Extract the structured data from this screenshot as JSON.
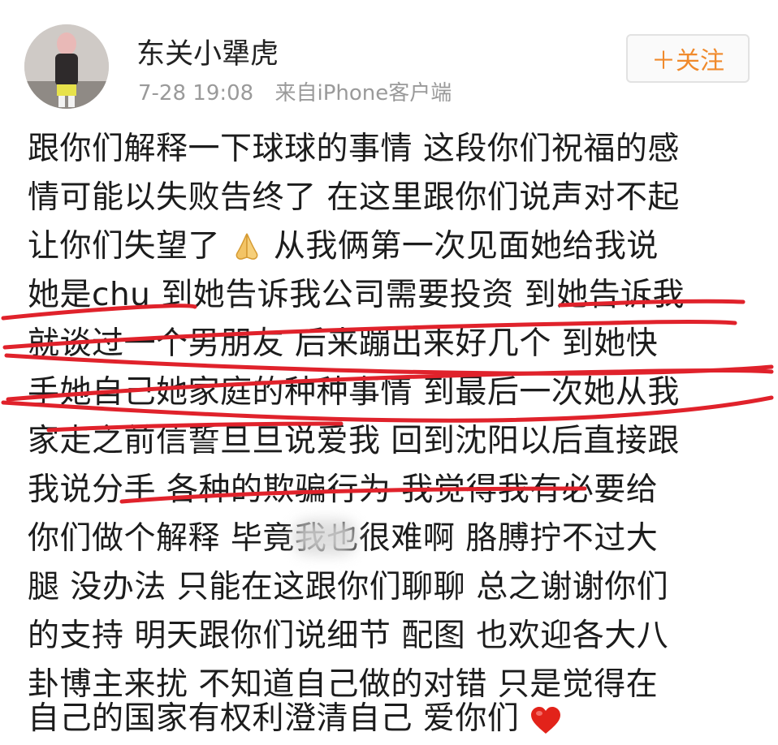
{
  "post": {
    "author": "东关小犟虎",
    "time": "7-28 19:08",
    "source": "来自iPhone客户端",
    "follow_label": "＋关注",
    "lines": [
      "跟你们解释一下球球的事情 这段你们祝福的感",
      "情可能以失败告终了 在这里跟你们说声对不起",
      "让你们失望了",
      "从我俩第一次见面她给我说",
      "她是chu 到她告诉我公司需要投资 到她告诉我",
      "就谈过一个男朋友 后来蹦出来好几个 到她快",
      "手她自己她家庭的种种事情 到最后一次她从我",
      "家走之前信誓旦旦说爱我 回到沈阳以后直接跟",
      "我说分手  各种的欺骗行为 我觉得我有必要给",
      "你们做个解释 毕竟我也很难啊 胳膊拧不过大",
      "腿 没办法 只能在这跟你们聊聊 总之谢谢你们",
      "的支持 明天跟你们说细节 配图 也欢迎各大八",
      "卦博主来扰 不知道自己做的对错 只是觉得在",
      "自己的国家有权利澄清自己 爱你们"
    ],
    "emoji": [
      "praying-hands-icon",
      "red-heart-icon"
    ]
  },
  "colors": {
    "follow_accent": "#f08a2c",
    "markup_red": "#e0222b",
    "meta_gray": "#9a9a9a"
  }
}
